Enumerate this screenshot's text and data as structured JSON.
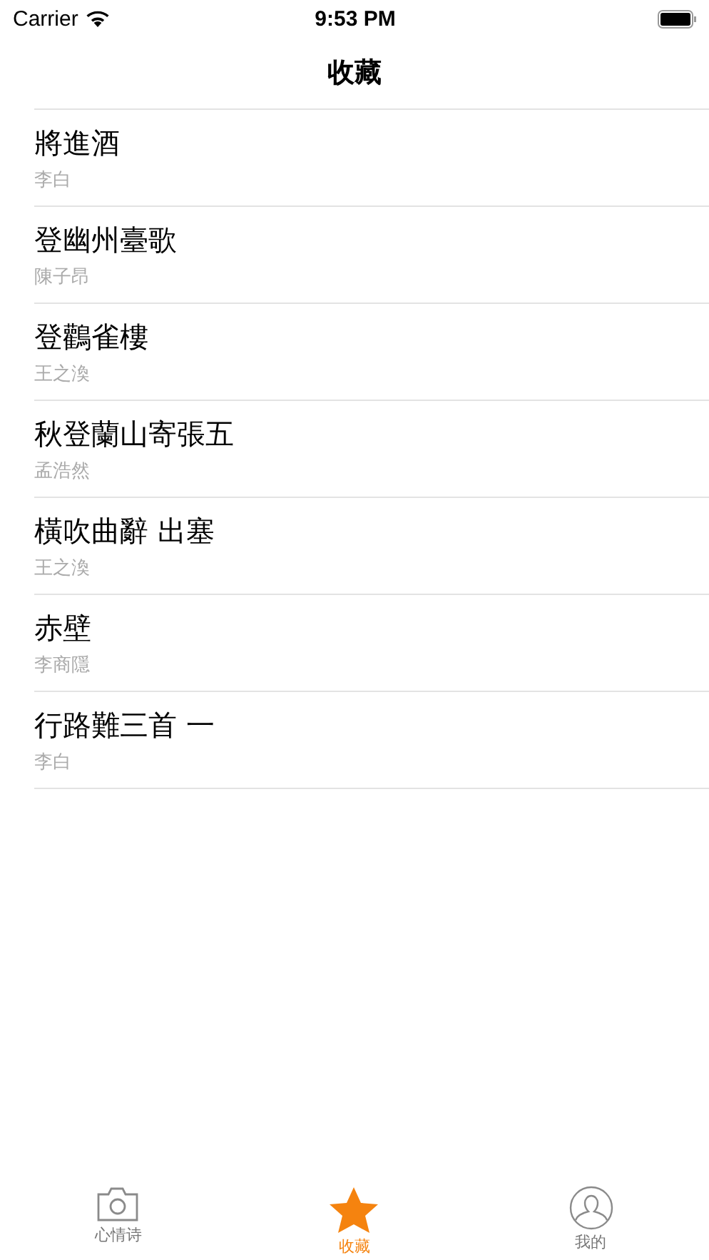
{
  "status_bar": {
    "carrier": "Carrier",
    "time": "9:53 PM"
  },
  "nav": {
    "title": "收藏"
  },
  "poems": [
    {
      "title": "將進酒",
      "author": "李白"
    },
    {
      "title": "登幽州臺歌",
      "author": "陳子昂"
    },
    {
      "title": "登鸛雀樓",
      "author": "王之渙"
    },
    {
      "title": "秋登蘭山寄張五",
      "author": "孟浩然"
    },
    {
      "title": "橫吹曲辭 出塞",
      "author": "王之渙"
    },
    {
      "title": "赤壁",
      "author": "李商隱"
    },
    {
      "title": "行路難三首 一",
      "author": "李白"
    }
  ],
  "tabs": [
    {
      "kind": "camera",
      "label": "心情诗",
      "selected": false
    },
    {
      "kind": "star",
      "label": "收藏",
      "selected": true
    },
    {
      "kind": "person",
      "label": "我的",
      "selected": false
    }
  ]
}
